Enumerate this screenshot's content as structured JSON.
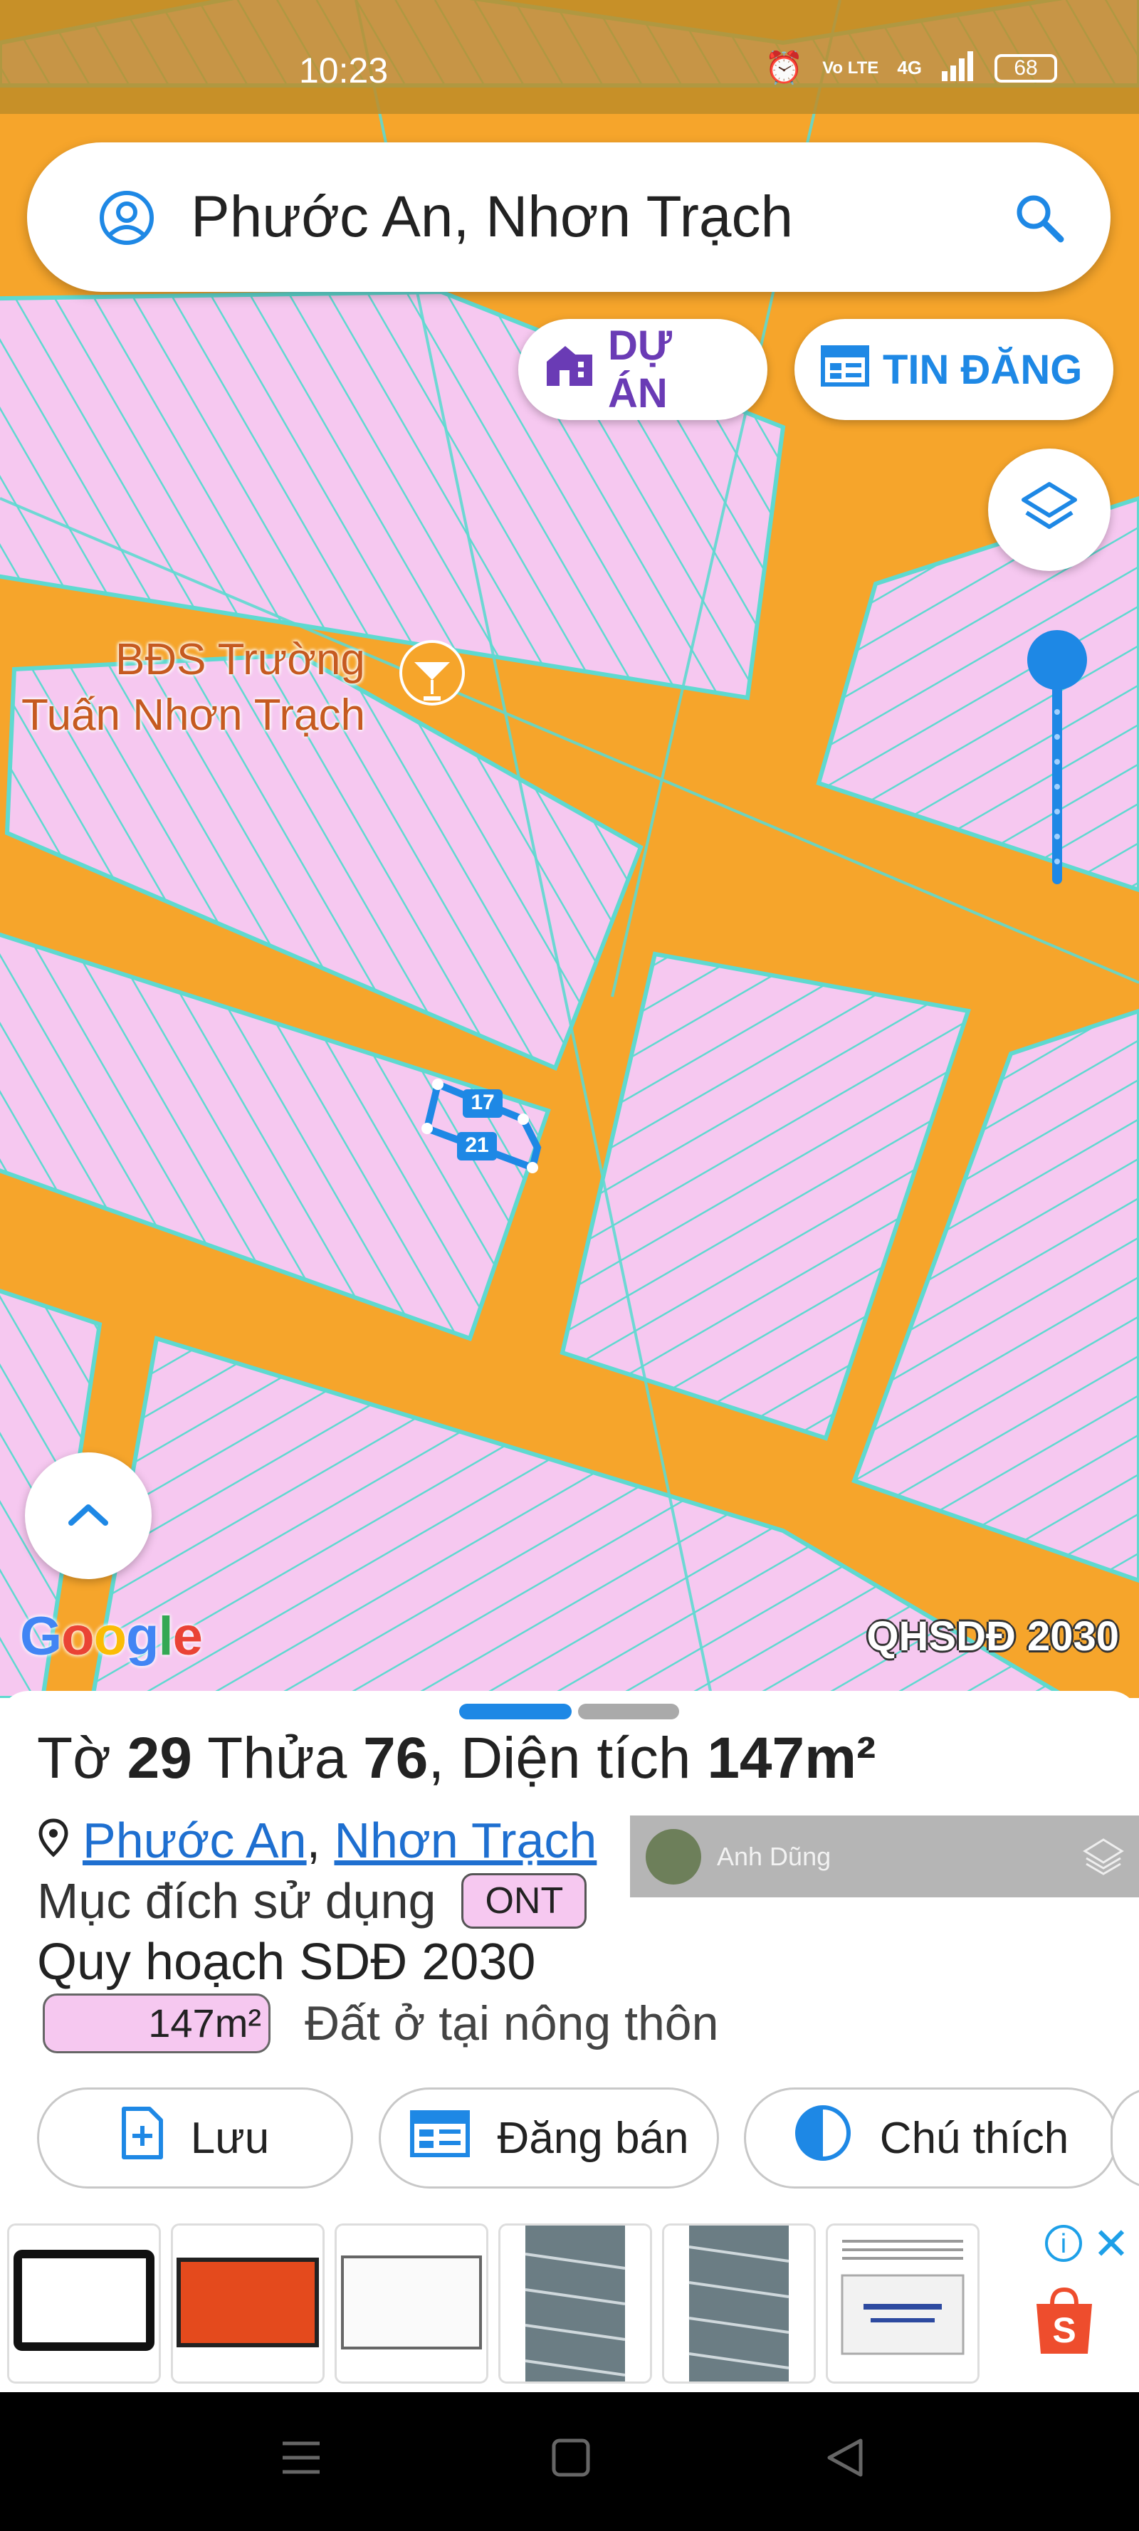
{
  "status_bar": {
    "time": "10:23",
    "network": "4G",
    "volte": "Vo LTE",
    "battery": "68"
  },
  "search": {
    "query": "Phước An, Nhơn Trạch"
  },
  "chips": {
    "du_an": "DỰ ÁN",
    "tin_dang": "TIN ĐĂNG"
  },
  "map": {
    "poi_label_line1": "BĐS Trường",
    "poi_label_line2": "Tuấn Nhơn Trạch",
    "parcel_top": "17",
    "parcel_bottom": "21",
    "google_logo": "Google",
    "layer_label": "QHSDĐ 2030",
    "colors": {
      "road": "#f6a52b",
      "lot": "#f6c8f0",
      "boundary": "#5fd9d0",
      "selection": "#1e88e5"
    }
  },
  "sheet": {
    "title_prefix": "Tờ ",
    "sheet_number": "29",
    "parcel_label": " Thửa ",
    "parcel_number": "76",
    "area_label": ", Diện tích ",
    "area_value": "147m²",
    "location_ward": "Phước An",
    "location_sep": ",",
    "location_district": "Nhơn Trạch",
    "purpose_label": "Mục đích sử dụng",
    "purpose_code": "ONT",
    "plan_title": "Quy hoạch SDĐ 2030",
    "plan_area": "147m²",
    "plan_desc": "Đất ở tại nông thôn",
    "buttons": {
      "save": "Lưu",
      "sell": "Đăng bán",
      "legend": "Chú thích"
    }
  },
  "overlay_user": {
    "name": "Anh Dũng"
  },
  "ad": {
    "info": "i",
    "close": "✕",
    "shop_letter": "S"
  }
}
